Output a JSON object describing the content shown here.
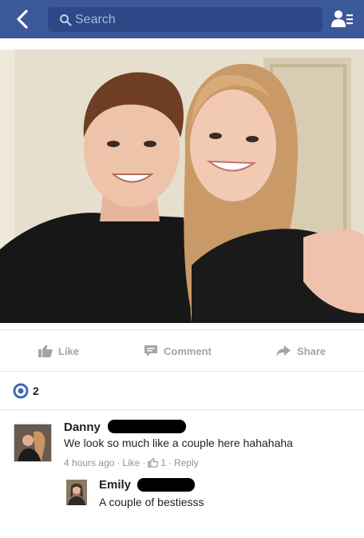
{
  "nav": {
    "search_placeholder": "Search",
    "back_icon": "back-arrow-icon",
    "friends_icon": "friend-requests-icon",
    "color": "#3b5998"
  },
  "actions": {
    "like": "Like",
    "comment": "Comment",
    "share": "Share"
  },
  "reactions": {
    "count": "2",
    "icon": "like-reaction-icon"
  },
  "comments": [
    {
      "author": "Danny",
      "text": "We look so much like a couple here hahahaha",
      "time": "4 hours ago",
      "like": "Like",
      "likes": "1",
      "reply": "Reply",
      "separator": "·"
    },
    {
      "author": "Emily",
      "text": "A couple of bestiesss"
    }
  ]
}
